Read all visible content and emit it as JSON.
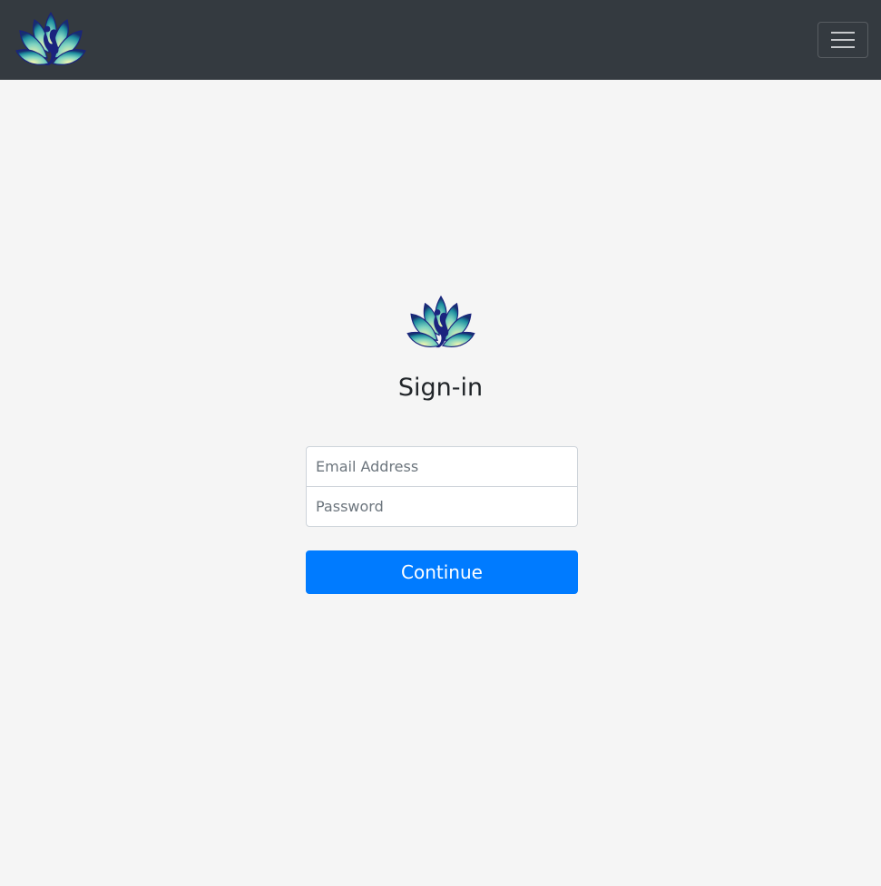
{
  "navbar": {
    "brand_logo": "lotus-yoga-logo-icon",
    "toggler_icon": "hamburger-menu-icon",
    "background": "#343a40"
  },
  "signin": {
    "logo": "lotus-yoga-logo-icon",
    "title": "Sign-in",
    "email": {
      "value": "",
      "placeholder": "Email Address"
    },
    "password": {
      "value": "",
      "placeholder": "Password"
    },
    "continue_label": "Continue"
  },
  "colors": {
    "page_background": "#f5f5f5",
    "primary": "#007bff",
    "logo_dark": "#1a237e",
    "logo_teal": "#26a69a",
    "logo_light": "#f0f4a8"
  }
}
